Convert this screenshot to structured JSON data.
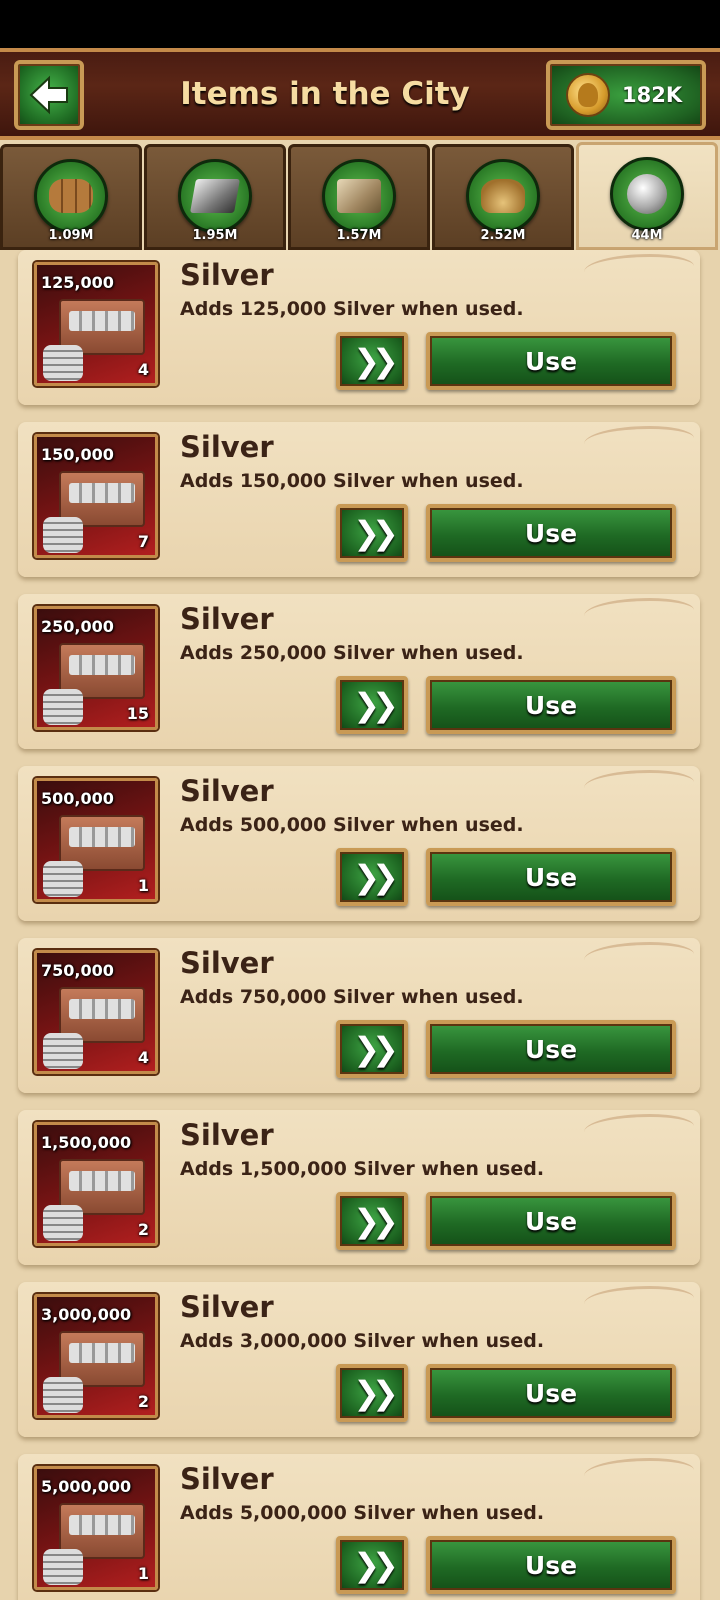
{
  "header": {
    "title": "Items in the City",
    "gold": "182K"
  },
  "tabs": [
    {
      "name": "wood",
      "count": "1.09M"
    },
    {
      "name": "iron",
      "count": "1.95M"
    },
    {
      "name": "stone",
      "count": "1.57M"
    },
    {
      "name": "food",
      "count": "2.52M"
    },
    {
      "name": "silver",
      "count": "44M"
    }
  ],
  "items": [
    {
      "amount": "125,000",
      "qty": "4",
      "name": "Silver",
      "desc": "Adds 125,000 Silver when used.",
      "speed": "❯❯",
      "use": "Use"
    },
    {
      "amount": "150,000",
      "qty": "7",
      "name": "Silver",
      "desc": "Adds 150,000 Silver when used.",
      "speed": "❯❯",
      "use": "Use"
    },
    {
      "amount": "250,000",
      "qty": "15",
      "name": "Silver",
      "desc": "Adds 250,000 Silver when used.",
      "speed": "❯❯",
      "use": "Use"
    },
    {
      "amount": "500,000",
      "qty": "1",
      "name": "Silver",
      "desc": "Adds 500,000 Silver when used.",
      "speed": "❯❯",
      "use": "Use"
    },
    {
      "amount": "750,000",
      "qty": "4",
      "name": "Silver",
      "desc": "Adds 750,000 Silver when used.",
      "speed": "❯❯",
      "use": "Use"
    },
    {
      "amount": "1,500,000",
      "qty": "2",
      "name": "Silver",
      "desc": "Adds 1,500,000 Silver when used.",
      "speed": "❯❯",
      "use": "Use"
    },
    {
      "amount": "3,000,000",
      "qty": "2",
      "name": "Silver",
      "desc": "Adds 3,000,000 Silver when used.",
      "speed": "❯❯",
      "use": "Use"
    },
    {
      "amount": "5,000,000",
      "qty": "1",
      "name": "Silver",
      "desc": "Adds 5,000,000 Silver when used.",
      "speed": "❯❯",
      "use": "Use"
    }
  ]
}
